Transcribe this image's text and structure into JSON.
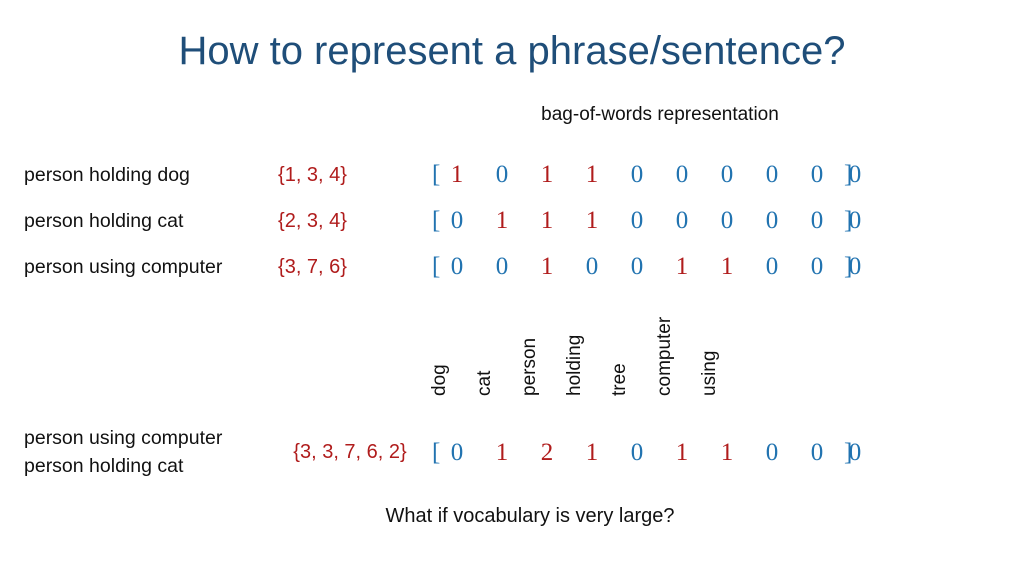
{
  "slide": {
    "title": "How to represent a phrase/sentence?",
    "subtitle": "bag-of-words representation",
    "footer_question": "What if vocabulary is very large?"
  },
  "colors": {
    "title": "#1F4E79",
    "red": "#B01C1C",
    "blue": "#2173B0",
    "text": "#111111",
    "background": "#FFFFFF"
  },
  "vocabulary": [
    "dog",
    "cat",
    "person",
    "holding",
    "tree",
    "computer",
    "using"
  ],
  "brackets": {
    "open": "[",
    "close": "]"
  },
  "rows": [
    {
      "phrase": "person holding dog",
      "index_set": "{1, 3, 4}",
      "vector": [
        1,
        0,
        1,
        1,
        0,
        0,
        0,
        0,
        0,
        0
      ]
    },
    {
      "phrase": "person holding cat",
      "index_set": "{2, 3, 4}",
      "vector": [
        0,
        1,
        1,
        1,
        0,
        0,
        0,
        0,
        0,
        0
      ]
    },
    {
      "phrase": "person using computer",
      "index_set": "{3, 7, 6}",
      "vector": [
        0,
        0,
        1,
        0,
        0,
        1,
        1,
        0,
        0,
        0
      ]
    }
  ],
  "bottom_row": {
    "phrase_line1": "person using computer",
    "phrase_line2": "person holding cat",
    "index_set": "{3, 3, 7, 6, 2}",
    "vector": [
      0,
      1,
      2,
      1,
      0,
      1,
      1,
      0,
      0,
      0
    ]
  },
  "chart_data": {
    "type": "table",
    "title": "bag-of-words representation",
    "columns": [
      "dog",
      "cat",
      "person",
      "holding",
      "tree",
      "computer",
      "using",
      "",
      "",
      ""
    ],
    "rows": [
      {
        "label": "person holding dog",
        "index_set": "{1, 3, 4}",
        "values": [
          1,
          0,
          1,
          1,
          0,
          0,
          0,
          0,
          0,
          0
        ]
      },
      {
        "label": "person holding cat",
        "index_set": "{2, 3, 4}",
        "values": [
          0,
          1,
          1,
          1,
          0,
          0,
          0,
          0,
          0,
          0
        ]
      },
      {
        "label": "person using computer",
        "index_set": "{3, 7, 6}",
        "values": [
          0,
          0,
          1,
          0,
          0,
          1,
          1,
          0,
          0,
          0
        ]
      },
      {
        "label": "person using computer person holding cat",
        "index_set": "{3, 3, 7, 6, 2}",
        "values": [
          0,
          1,
          2,
          1,
          0,
          1,
          1,
          0,
          0,
          0
        ]
      }
    ]
  }
}
